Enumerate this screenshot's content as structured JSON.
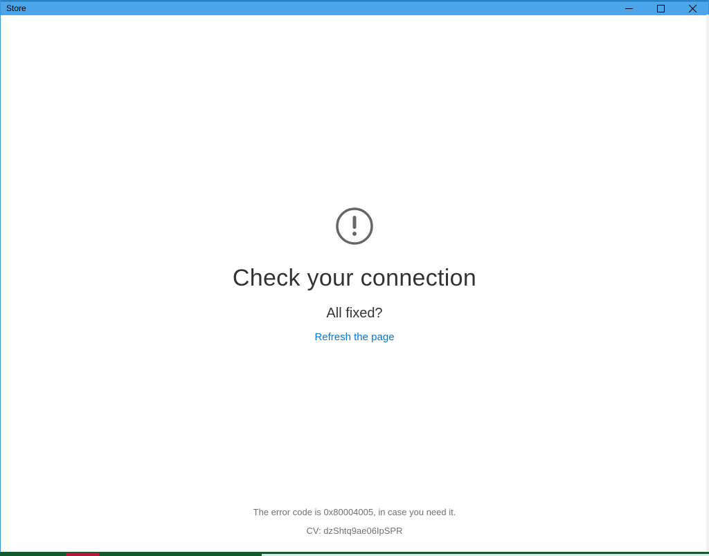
{
  "window": {
    "title": "Store"
  },
  "error": {
    "heading": "Check your connection",
    "subheading": "All fixed?",
    "refresh_link": "Refresh the page",
    "error_code_text": "The error code is 0x80004005, in case you need it.",
    "cv_text": "CV: dzShtq9ae06IpSPR"
  }
}
